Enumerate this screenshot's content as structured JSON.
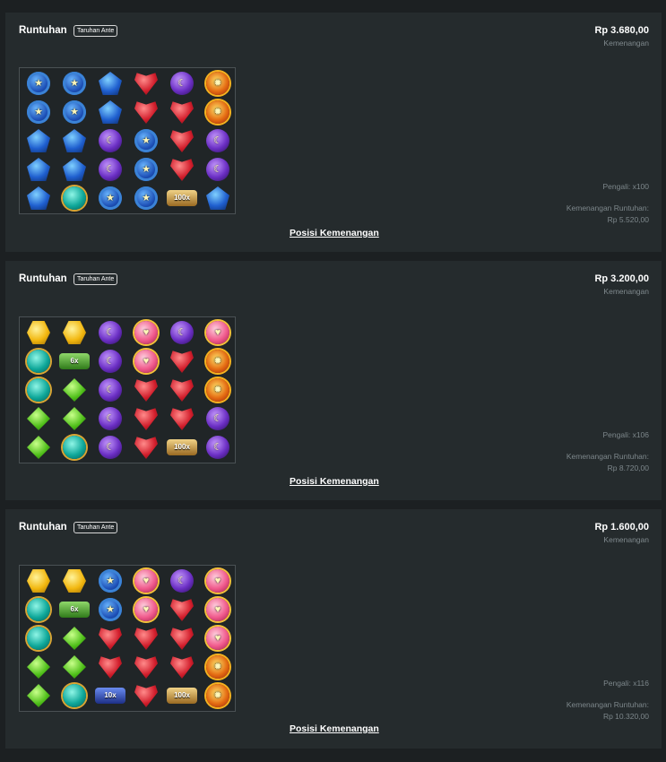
{
  "panels": [
    {
      "title": "Runtuhan",
      "badge": "Taruhan Ante",
      "amount": "Rp 3.680,00",
      "amount_label": "Kemenangan",
      "multiplier_label": "Pengali: x100",
      "cascade_label": "Kemenangan Runtuhan:",
      "cascade_value": "Rp 5.520,00",
      "link": "Posisi Kemenangan",
      "grid": [
        [
          "star",
          "star",
          "blue",
          "red",
          "moon",
          "sun"
        ],
        [
          "star",
          "star",
          "blue",
          "red",
          "red",
          "sun"
        ],
        [
          "blue",
          "blue",
          "moon",
          "star",
          "red",
          "moon"
        ],
        [
          "blue",
          "blue",
          "moon",
          "star",
          "red",
          "moon"
        ],
        [
          "blue",
          "teal",
          "star",
          "star",
          "100x",
          "blue"
        ]
      ]
    },
    {
      "title": "Runtuhan",
      "badge": "Taruhan Ante",
      "amount": "Rp 3.200,00",
      "amount_label": "Kemenangan",
      "multiplier_label": "Pengali: x106",
      "cascade_label": "Kemenangan Runtuhan:",
      "cascade_value": "Rp 8.720,00",
      "link": "Posisi Kemenangan",
      "grid": [
        [
          "yel",
          "yel",
          "moon",
          "pink",
          "moon",
          "pink"
        ],
        [
          "teal",
          "6x",
          "moon",
          "pink",
          "red",
          "sun"
        ],
        [
          "teal",
          "green",
          "moon",
          "red",
          "red",
          "sun"
        ],
        [
          "green",
          "green",
          "moon",
          "red",
          "red",
          "moon"
        ],
        [
          "green",
          "teal",
          "moon",
          "red",
          "100x",
          "moon"
        ]
      ]
    },
    {
      "title": "Runtuhan",
      "badge": "Taruhan Ante",
      "amount": "Rp 1.600,00",
      "amount_label": "Kemenangan",
      "multiplier_label": "Pengali: x116",
      "cascade_label": "Kemenangan Runtuhan:",
      "cascade_value": "Rp 10.320,00",
      "link": "Posisi Kemenangan",
      "grid": [
        [
          "yel",
          "yel",
          "star",
          "pink",
          "moon",
          "pink"
        ],
        [
          "teal",
          "6x",
          "star",
          "pink",
          "red",
          "pink"
        ],
        [
          "teal",
          "green",
          "red",
          "red",
          "red",
          "pink"
        ],
        [
          "green",
          "green",
          "red",
          "red",
          "red",
          "sun"
        ],
        [
          "green",
          "teal",
          "10x",
          "red",
          "100x",
          "sun"
        ]
      ]
    }
  ],
  "symbol_icons": {
    "star": "star-gem-icon",
    "blue": "blue-gem-icon",
    "red": "red-heart-gem-icon",
    "moon": "purple-moon-gem-icon",
    "sun": "sun-gem-icon",
    "teal": "teal-gem-icon",
    "yel": "yellow-gem-icon",
    "green": "green-gem-icon",
    "pink": "pink-heart-gem-icon"
  }
}
